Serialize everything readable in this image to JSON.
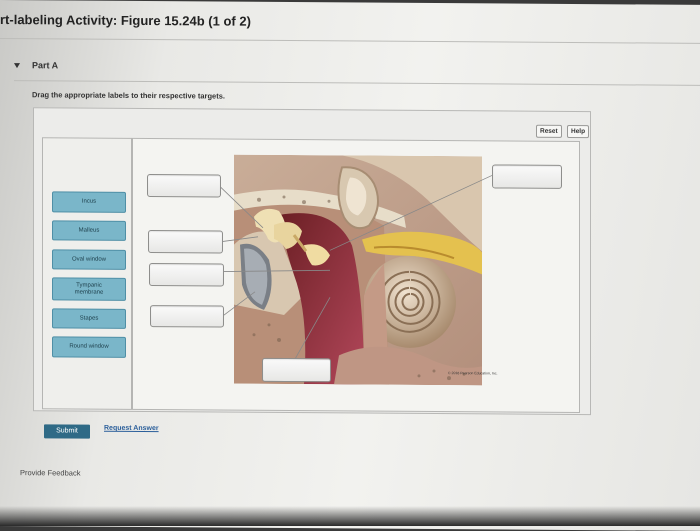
{
  "header": {
    "title": "rt-labeling Activity: Figure 15.24b (1 of 2)"
  },
  "part": {
    "label": "Part A"
  },
  "instructions": "Drag the appropriate labels to their respective targets.",
  "toolbar": {
    "reset_label": "Reset",
    "help_label": "Help"
  },
  "labels": [
    "Incus",
    "Malleus",
    "Oval window",
    "Tympanic\nmembrane",
    "Stapes",
    "Round window"
  ],
  "figure": {
    "copyright": "© 2016 Pearson Education, Inc."
  },
  "actions": {
    "submit_label": "Submit",
    "request_answer_label": "Request Answer"
  },
  "footer": {
    "feedback_label": "Provide Feedback"
  }
}
